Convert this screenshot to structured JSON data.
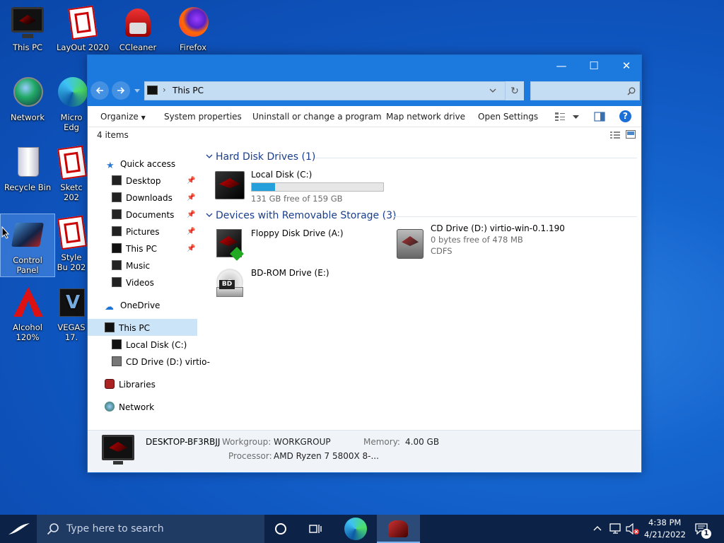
{
  "desktop": {
    "icons": [
      {
        "label": "This PC"
      },
      {
        "label": "LayOut 2020"
      },
      {
        "label": "CCleaner"
      },
      {
        "label": "Firefox"
      },
      {
        "label": "Network"
      },
      {
        "label": "Micro Edg"
      },
      {
        "label": "Recycle Bin"
      },
      {
        "label": "Sketc 202"
      },
      {
        "label": "Control Panel"
      },
      {
        "label": "Style Bu 202"
      },
      {
        "label": "Alcohol 120%"
      },
      {
        "label": "VEGAS 17."
      }
    ]
  },
  "window": {
    "controls": {
      "minimize": "—",
      "maximize": "☐",
      "close": "✕"
    },
    "address": {
      "path": "This PC",
      "separator": "›"
    },
    "search": {
      "placeholder": ""
    },
    "commands": {
      "organize": "Organize",
      "system_properties": "System properties",
      "uninstall": "Uninstall or change a program",
      "map_drive": "Map network drive",
      "open_settings": "Open Settings"
    },
    "item_count": "4 items",
    "nav": {
      "quick_access": "Quick access",
      "desktop": "Desktop",
      "downloads": "Downloads",
      "documents": "Documents",
      "pictures": "Pictures",
      "this_pc_pinned": "This PC",
      "music": "Music",
      "videos": "Videos",
      "onedrive": "OneDrive",
      "this_pc": "This PC",
      "local_disk": "Local Disk (C:)",
      "cd_drive": "CD Drive (D:) virtio-",
      "libraries": "Libraries",
      "network": "Network"
    },
    "groups": {
      "hard_disks": "Hard Disk Drives (1)",
      "removable": "Devices with Removable Storage (3)"
    },
    "drives": {
      "c": {
        "name": "Local Disk (C:)",
        "free": "131 GB free of 159 GB",
        "used_fraction": 0.18
      },
      "a": {
        "name": "Floppy Disk Drive (A:)"
      },
      "d": {
        "name": "CD Drive (D:) virtio-win-0.1.190",
        "free": "0 bytes free of 478 MB",
        "fs": "CDFS"
      },
      "e": {
        "name": "BD-ROM Drive (E:)",
        "badge": "BD"
      }
    },
    "details": {
      "computer_name": "DESKTOP-BF3RBJJ",
      "workgroup_label": "Workgroup:",
      "workgroup": "WORKGROUP",
      "memory_label": "Memory:",
      "memory": "4.00 GB",
      "processor_label": "Processor:",
      "processor": "AMD Ryzen 7 5800X 8-..."
    }
  },
  "taskbar": {
    "search_placeholder": "Type here to search",
    "time": "4:38 PM",
    "date": "4/21/2022",
    "notification_count": "1"
  },
  "colors": {
    "accent": "#1c79dd",
    "address_bg": "#c5ddf2",
    "progress": "#26a0da",
    "group_header": "#1a3e8c",
    "taskbar": "#0c2347"
  }
}
